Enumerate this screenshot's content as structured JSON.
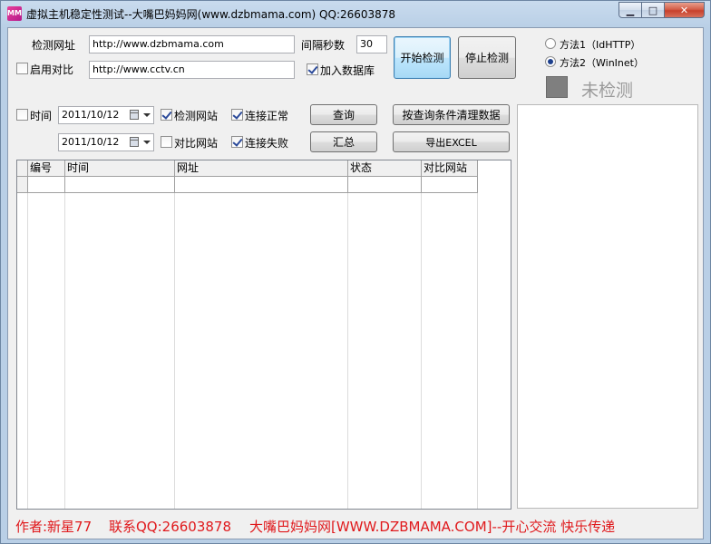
{
  "window": {
    "title": "虚拟主机稳定性测试--大嘴巴妈妈网(www.dzbmama.com)  QQ:26603878",
    "icon_label": "MM",
    "minimize_glyph": "▁",
    "maximize_glyph": "□",
    "close_glyph": "✕"
  },
  "form": {
    "check_url_label": "检测网址",
    "check_url_value": "http://www.dzbmama.com",
    "enable_compare_label": "启用对比",
    "enable_compare_checked": false,
    "compare_url_value": "http://www.cctv.cn",
    "interval_label": "间隔秒数",
    "interval_value": "30",
    "add_db_label": "加入数据库",
    "add_db_checked": true,
    "start_button": "开始检测",
    "stop_button": "停止检测"
  },
  "methods": {
    "method1_label": "方法1（IdHTTP）",
    "method2_label": "方法2（WinInet）",
    "selected": 2
  },
  "status": {
    "text": "未检测",
    "swatch_color": "#7f7f7f"
  },
  "filters": {
    "time_label": "时间",
    "time_checked": false,
    "date_from": "2011/10/12",
    "date_to": "2011/10/12",
    "check_site_label": "检测网站",
    "check_site_checked": true,
    "compare_site_label": "对比网站",
    "compare_site_checked": false,
    "conn_ok_label": "连接正常",
    "conn_ok_checked": true,
    "conn_fail_label": "连接失败",
    "conn_fail_checked": true,
    "query_button": "查询",
    "summary_button": "汇总",
    "clear_button": "按查询条件清理数据",
    "export_button": "导出EXCEL"
  },
  "table": {
    "columns": [
      "编号",
      "时间",
      "网址",
      "状态",
      "对比网站"
    ]
  },
  "footer": {
    "author": "作者:新星77",
    "contact": "联系QQ:26603878",
    "site": "大嘴巴妈妈网[WWW.DZBMAMA.COM]--开心交流 快乐传递",
    "color": "#e0191c"
  }
}
